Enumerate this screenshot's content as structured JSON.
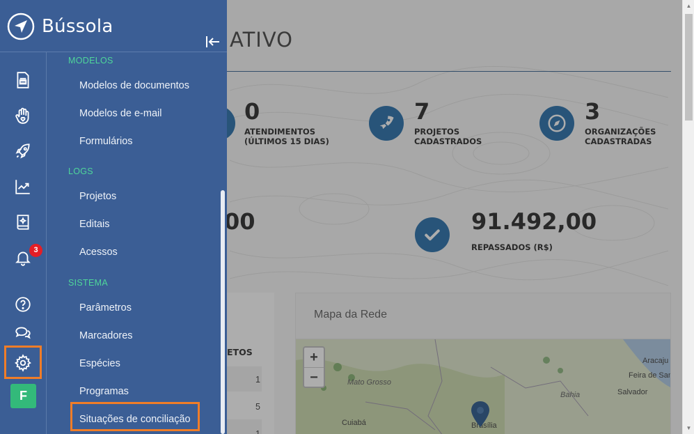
{
  "dashboard": {
    "title_fragment": "ATIVO",
    "stats": [
      {
        "value": "0",
        "label": "ATENDIMENTOS (ÚLTIMOS 15 DIAS)"
      },
      {
        "value": "7",
        "label": "PROJETOS CADASTRADOS",
        "icon": "rocket-icon"
      },
      {
        "value": "3",
        "label": "ORGANIZAÇÕES CADASTRADAS",
        "icon": "compass-icon"
      },
      {
        "value": "00",
        "label": ""
      },
      {
        "value": "91.492,00",
        "label": "REPASSADOS (R$)",
        "icon": "check-icon"
      }
    ],
    "table": {
      "header": "ETOS",
      "cells": [
        "1",
        "5",
        "1"
      ]
    },
    "map": {
      "title": "Mapa da Rede",
      "zoom_in": "+",
      "zoom_out": "−",
      "labels": [
        "Mato Grosso",
        "Bahia",
        "Aracaju",
        "Feira de San",
        "Salvador",
        "Cuiabá",
        "Brasília"
      ]
    }
  },
  "sidebar": {
    "brand": "Bússola",
    "notification_count": "3",
    "avatar_initial": "F",
    "sections": [
      {
        "title": "MODELOS",
        "items": [
          "Modelos de documentos",
          "Modelos de e-mail",
          "Formulários"
        ]
      },
      {
        "title": "LOGS",
        "items": [
          "Projetos",
          "Editais",
          "Acessos"
        ]
      },
      {
        "title": "SISTEMA",
        "items": [
          "Parâmetros",
          "Marcadores",
          "Espécies",
          "Programas",
          "Situações de conciliação"
        ]
      }
    ],
    "colors": {
      "sidebar_bg": "#3b5e95",
      "section_title": "#4fd69a",
      "highlight": "#f07d28",
      "badge": "#e41e26",
      "avatar": "#33b97a"
    }
  }
}
